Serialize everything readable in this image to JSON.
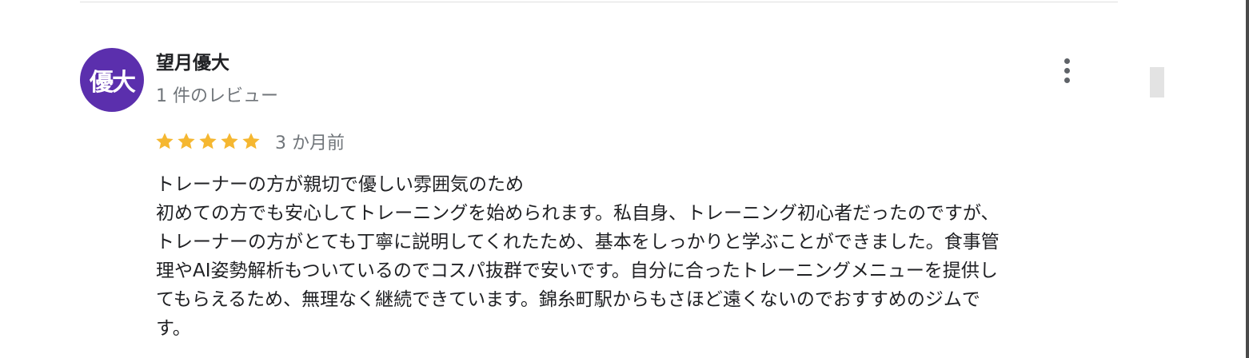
{
  "review": {
    "avatar_text": "優大",
    "author_name": "望月優大",
    "review_count": "1 件のレビュー",
    "rating": 5,
    "rating_max": 5,
    "date": "3 か月前",
    "lines": [
      "トレーナーの方が親切で優しい雰囲気のため",
      "初めての方でも安心してトレーニングを始められます。私自身、トレーニング初心者だったのですが、",
      "トレーナーの方がとても丁寧に説明してくれたため、基本をしっかりと学ぶことができました。食事管",
      "理やAI姿勢解析もついているのでコスパ抜群で安いです。自分に合ったトレーニングメニューを提供し",
      "てもらえるため、無理なく継続できています。錦糸町駅からもさほど遠くないのでおすすめのジムで",
      "す。"
    ]
  },
  "icons": {
    "more": "more-vert-icon",
    "star": "star-icon"
  },
  "colors": {
    "avatar_bg": "#5b2fad",
    "star": "#f5b731",
    "secondary_text": "#70757a",
    "primary_text": "#202124"
  }
}
